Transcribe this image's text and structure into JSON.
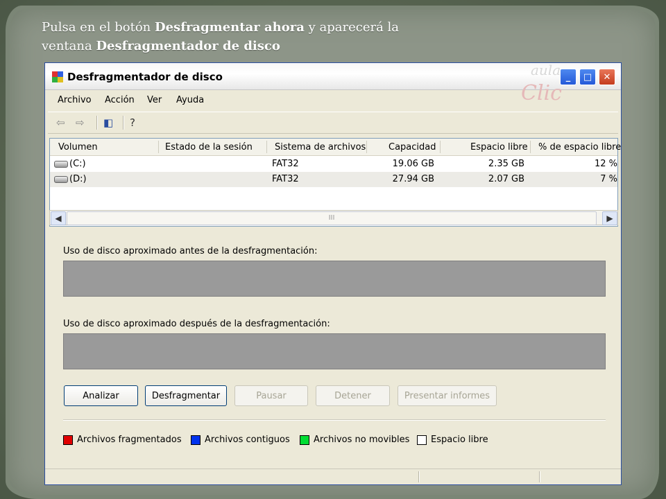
{
  "caption": {
    "line1_prefix": "Pulsa en el botón ",
    "line1_bold": "Desfragmentar ahora",
    "line1_suffix": " y aparecerá la",
    "line2_prefix": "ventana ",
    "line2_bold": "Desfragmentador de disco"
  },
  "window": {
    "title": "Desfragmentador de disco",
    "logo_top": "aula",
    "logo_bottom": "Clic",
    "minimize": "_",
    "maximize": "□",
    "close": "✕"
  },
  "menu": [
    "Archivo",
    "Acción",
    "Ver",
    "Ayuda"
  ],
  "toolbar_icons": [
    "back-arrow-icon",
    "forward-arrow-icon",
    "console-tree-icon",
    "help-icon"
  ],
  "table": {
    "columns": [
      "Volumen",
      "Estado de la sesión",
      "Sistema de archivos",
      "Capacidad",
      "Espacio libre",
      "% de espacio libre"
    ],
    "rows": [
      {
        "volume": "(C:)",
        "status": "",
        "fs": "FAT32",
        "capacity": "19.06 GB",
        "free": "2.35 GB",
        "pct": "12 %"
      },
      {
        "volume": "(D:)",
        "status": "",
        "fs": "FAT32",
        "capacity": "27.94 GB",
        "free": "2.07 GB",
        "pct": "7 %"
      }
    ]
  },
  "scroll_thumb": "III",
  "before_label": "Uso de disco aproximado antes de la desfragmentación:",
  "after_label": "Uso de disco aproximado después de la desfragmentación:",
  "buttons": {
    "analyze": "Analizar",
    "defrag": "Desfragmentar",
    "pause": "Pausar",
    "stop": "Detener",
    "report": "Presentar informes"
  },
  "legend": [
    {
      "label": "Archivos fragmentados",
      "color": "#e00000"
    },
    {
      "label": "Archivos contiguos",
      "color": "#0033ee"
    },
    {
      "label": "Archivos no movibles",
      "color": "#00dd33"
    },
    {
      "label": "Espacio libre",
      "color": "#ffffff"
    }
  ]
}
